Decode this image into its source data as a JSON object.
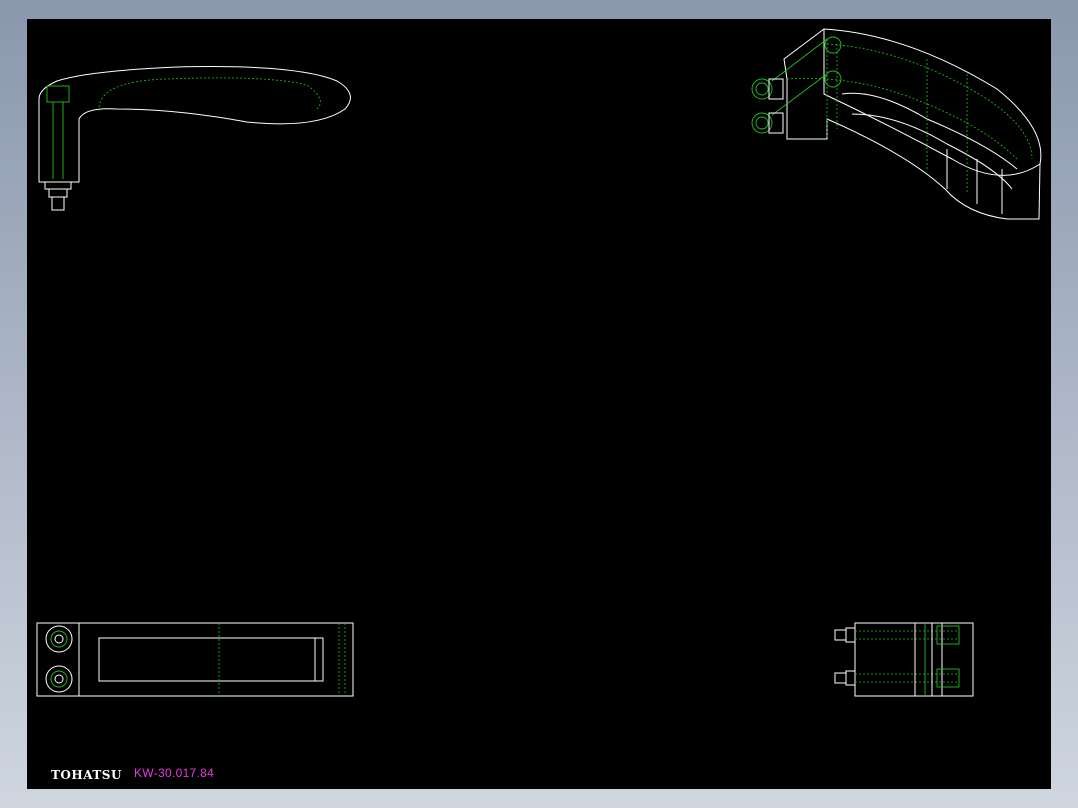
{
  "drawing": {
    "logo_text": "TOHATSU",
    "drawing_number": "KW-30.017.84"
  },
  "colors": {
    "workspace_bg": "#000000",
    "outline": "#ffffff",
    "hidden_lines": "#1fc21f",
    "drawing_number_text": "#e03ce0"
  }
}
